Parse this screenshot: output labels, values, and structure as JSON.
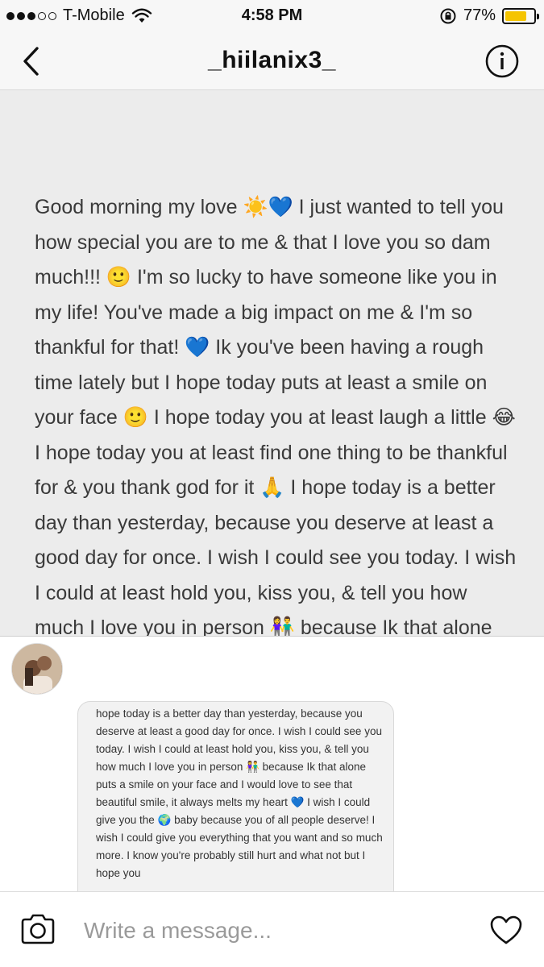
{
  "status_bar": {
    "carrier": "T-Mobile",
    "time": "4:58 PM",
    "battery_percent": "77%",
    "battery_level": 0.77,
    "signal_bars_filled": 3,
    "signal_bars_total": 5
  },
  "header": {
    "title": "_hiilanix3_"
  },
  "message_image": {
    "text": "Good morning my love ☀️💙 I just wanted to tell you how special you are to me & that I love you so dam much!!! 🙂 I'm so lucky to have someone like you in my life! You've made a big impact on me & I'm so thankful for that! 💙 Ik you've been having a rough time lately but I hope today puts at least a smile on your face 🙂 I hope today you at least laugh a little 😂 I hope today you at least find one thing to be thankful for & you thank god for it 🙏 I hope today is a better day than yesterday, because you deserve at least a good day for once. I wish I could see you today. I wish I could at least hold you, kiss you, & tell you how much I love you in person 👫 because Ik that alone puts a smile on your face and I would love to see that beautiful smile, it always melts my heart 💙 I wish I could"
  },
  "thumbnail": {
    "text": "hope today is a better day than yesterday, because you deserve at least a good day for once. I wish I could see you today. I wish I could at least hold you, kiss you, & tell you how much I love you in person 👫 because Ik that alone puts a smile on your face and I would love to see that beautiful smile, it always melts my heart 💙 I wish I could give you the 🌍 baby because you of all people deserve! I wish I could give you everything that you want and so much more. I know you're probably still hurt and what not but I hope you"
  },
  "composer": {
    "placeholder": "Write a message..."
  },
  "icons": {
    "back": "chevron-left-icon",
    "info": "info-icon",
    "camera": "camera-icon",
    "heart": "heart-icon"
  },
  "colors": {
    "battery": "#f5c400",
    "header_bg": "#f7f7f7"
  }
}
